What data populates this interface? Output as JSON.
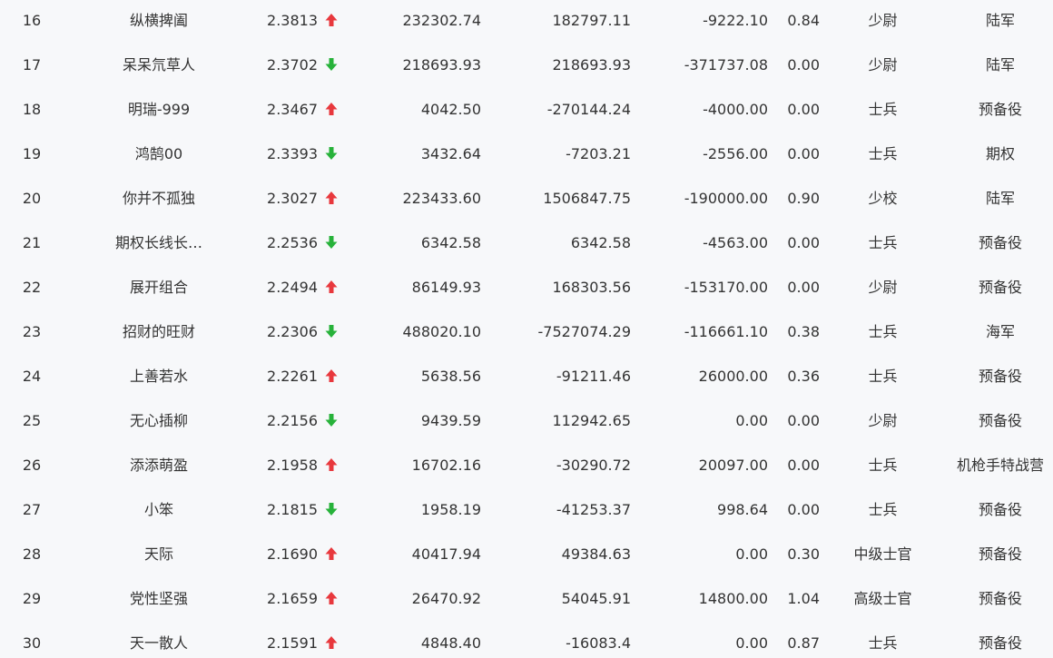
{
  "colors": {
    "background": "#f7f8fa",
    "text": "#333333",
    "up": "#e8383d",
    "down": "#27b23a"
  },
  "rows": [
    {
      "rank": "16",
      "name": "纵横捭阖",
      "score": "2.3813",
      "trend": "up",
      "v1": "232302.74",
      "v2": "182797.11",
      "v3": "-9222.10",
      "v4": "0.84",
      "rank_name": "少尉",
      "branch": "陆军"
    },
    {
      "rank": "17",
      "name": "呆呆氘草人",
      "score": "2.3702",
      "trend": "down",
      "v1": "218693.93",
      "v2": "218693.93",
      "v3": "-371737.08",
      "v4": "0.00",
      "rank_name": "少尉",
      "branch": "陆军"
    },
    {
      "rank": "18",
      "name": "明瑞-999",
      "score": "2.3467",
      "trend": "up",
      "v1": "4042.50",
      "v2": "-270144.24",
      "v3": "-4000.00",
      "v4": "0.00",
      "rank_name": "士兵",
      "branch": "预备役"
    },
    {
      "rank": "19",
      "name": "鸿鹄00",
      "score": "2.3393",
      "trend": "down",
      "v1": "3432.64",
      "v2": "-7203.21",
      "v3": "-2556.00",
      "v4": "0.00",
      "rank_name": "士兵",
      "branch": "期权"
    },
    {
      "rank": "20",
      "name": "你并不孤独",
      "score": "2.3027",
      "trend": "up",
      "v1": "223433.60",
      "v2": "1506847.75",
      "v3": "-190000.00",
      "v4": "0.90",
      "rank_name": "少校",
      "branch": "陆军"
    },
    {
      "rank": "21",
      "name": "期权长线长…",
      "score": "2.2536",
      "trend": "down",
      "v1": "6342.58",
      "v2": "6342.58",
      "v3": "-4563.00",
      "v4": "0.00",
      "rank_name": "士兵",
      "branch": "预备役"
    },
    {
      "rank": "22",
      "name": "展开组合",
      "score": "2.2494",
      "trend": "up",
      "v1": "86149.93",
      "v2": "168303.56",
      "v3": "-153170.00",
      "v4": "0.00",
      "rank_name": "少尉",
      "branch": "预备役"
    },
    {
      "rank": "23",
      "name": "招财的旺财",
      "score": "2.2306",
      "trend": "down",
      "v1": "488020.10",
      "v2": "-7527074.29",
      "v3": "-116661.10",
      "v4": "0.38",
      "rank_name": "士兵",
      "branch": "海军"
    },
    {
      "rank": "24",
      "name": "上善若水",
      "score": "2.2261",
      "trend": "up",
      "v1": "5638.56",
      "v2": "-91211.46",
      "v3": "26000.00",
      "v4": "0.36",
      "rank_name": "士兵",
      "branch": "预备役"
    },
    {
      "rank": "25",
      "name": "无心插柳",
      "score": "2.2156",
      "trend": "down",
      "v1": "9439.59",
      "v2": "112942.65",
      "v3": "0.00",
      "v4": "0.00",
      "rank_name": "少尉",
      "branch": "预备役"
    },
    {
      "rank": "26",
      "name": "添添萌盈",
      "score": "2.1958",
      "trend": "up",
      "v1": "16702.16",
      "v2": "-30290.72",
      "v3": "20097.00",
      "v4": "0.00",
      "rank_name": "士兵",
      "branch": "机枪手特战营"
    },
    {
      "rank": "27",
      "name": "小笨",
      "score": "2.1815",
      "trend": "down",
      "v1": "1958.19",
      "v2": "-41253.37",
      "v3": "998.64",
      "v4": "0.00",
      "rank_name": "士兵",
      "branch": "预备役"
    },
    {
      "rank": "28",
      "name": "天际",
      "score": "2.1690",
      "trend": "up",
      "v1": "40417.94",
      "v2": "49384.63",
      "v3": "0.00",
      "v4": "0.30",
      "rank_name": "中级士官",
      "branch": "预备役"
    },
    {
      "rank": "29",
      "name": "党性坚强",
      "score": "2.1659",
      "trend": "up",
      "v1": "26470.92",
      "v2": "54045.91",
      "v3": "14800.00",
      "v4": "1.04",
      "rank_name": "高级士官",
      "branch": "预备役"
    },
    {
      "rank": "30",
      "name": "天一散人",
      "score": "2.1591",
      "trend": "up",
      "v1": "4848.40",
      "v2": "-16083.4",
      "v3": "0.00",
      "v4": "0.87",
      "rank_name": "士兵",
      "branch": "预备役"
    }
  ]
}
